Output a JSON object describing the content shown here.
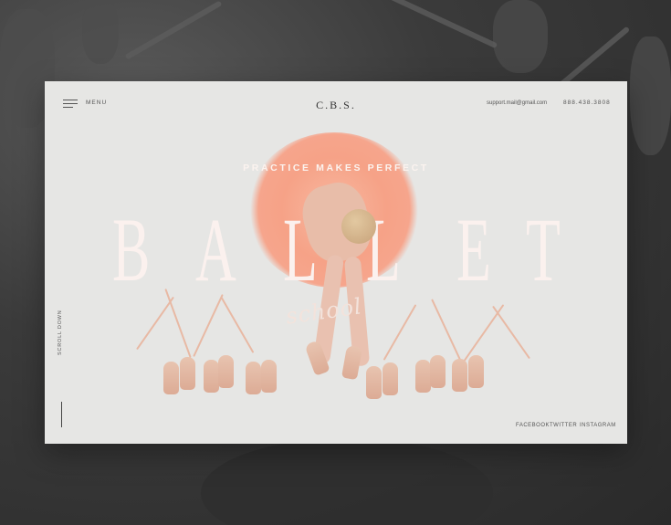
{
  "nav": {
    "menu_label": "MENU",
    "logo": "C.B.S.",
    "email": "support.mail@gmail.com",
    "phone": "888.438.3808"
  },
  "hero": {
    "tagline": "PRACTICE MAKES PERFECT",
    "title_letters": [
      "B",
      "A",
      "L",
      "L",
      "E",
      "T"
    ],
    "subtitle": "school"
  },
  "sidebar": {
    "scroll_label": "SCROLL DOWN"
  },
  "social": {
    "facebook": "FACEBOOK",
    "twitter": "TWITTER",
    "instagram": "INSTAGRAM"
  },
  "colors": {
    "card_bg": "#e6e6e4",
    "accent_peach": "#f6a287",
    "title_white": "#fbf1ee",
    "backdrop": "#3a3a3a"
  }
}
